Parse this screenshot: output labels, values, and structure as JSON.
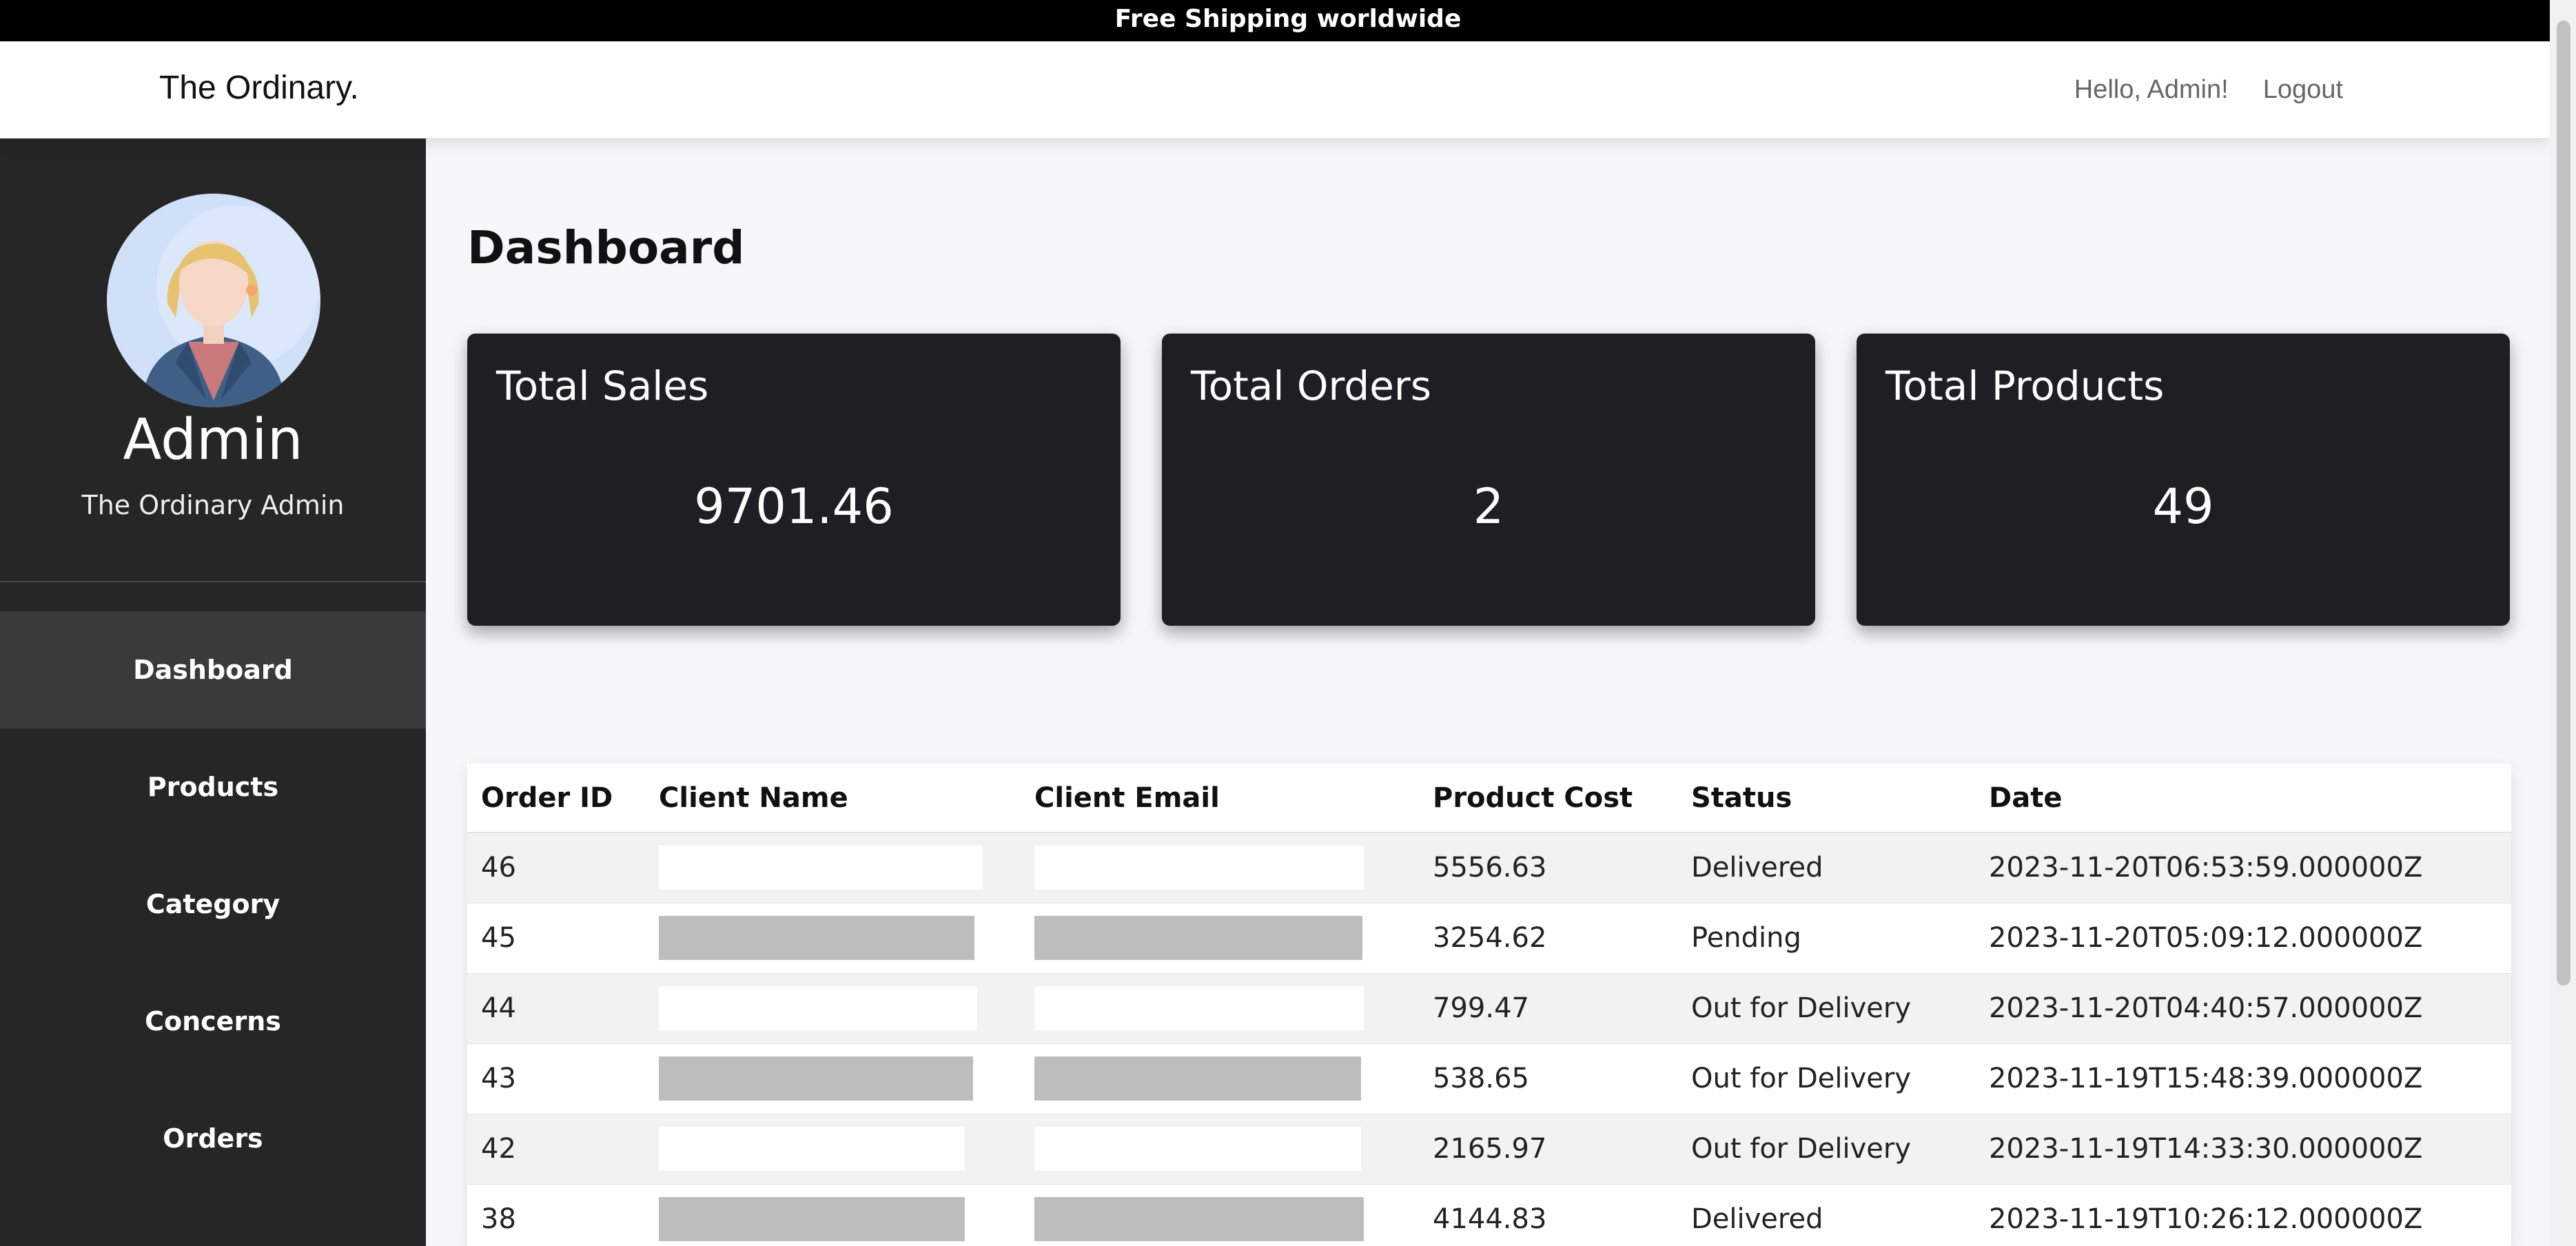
{
  "announcement": "Free Shipping worldwide",
  "navbar": {
    "brand": "The Ordinary.",
    "greeting": "Hello, Admin!",
    "logout": "Logout"
  },
  "sidebar": {
    "name": "Admin",
    "subtitle": "The Ordinary Admin",
    "items": [
      {
        "label": "Dashboard",
        "active": true
      },
      {
        "label": "Products"
      },
      {
        "label": "Category"
      },
      {
        "label": "Concerns"
      },
      {
        "label": "Orders"
      }
    ]
  },
  "dashboard": {
    "title": "Dashboard",
    "cards": [
      {
        "label": "Total Sales",
        "value": "9701.46"
      },
      {
        "label": "Total Orders",
        "value": "2"
      },
      {
        "label": "Total Products",
        "value": "49"
      }
    ]
  },
  "orders": {
    "columns": [
      "Order ID",
      "Client Name",
      "Client Email",
      "Product Cost",
      "Status",
      "Date"
    ],
    "rows": [
      {
        "id": "46",
        "name": "",
        "email": "",
        "cost": "5556.63",
        "status": "Delivered",
        "date": "2023-11-20T06:53:59.000000Z"
      },
      {
        "id": "45",
        "name": "",
        "email": "",
        "cost": "3254.62",
        "status": "Pending",
        "date": "2023-11-20T05:09:12.000000Z"
      },
      {
        "id": "44",
        "name": "",
        "email": "",
        "cost": "799.47",
        "status": "Out for Delivery",
        "date": "2023-11-20T04:40:57.000000Z"
      },
      {
        "id": "43",
        "name": "",
        "email": "",
        "cost": "538.65",
        "status": "Out for Delivery",
        "date": "2023-11-19T15:48:39.000000Z"
      },
      {
        "id": "42",
        "name": "",
        "email": "",
        "cost": "2165.97",
        "status": "Out for Delivery",
        "date": "2023-11-19T14:33:30.000000Z"
      },
      {
        "id": "38",
        "name": "",
        "email": "",
        "cost": "4144.83",
        "status": "Delivered",
        "date": "2023-11-19T10:26:12.000000Z"
      }
    ]
  }
}
